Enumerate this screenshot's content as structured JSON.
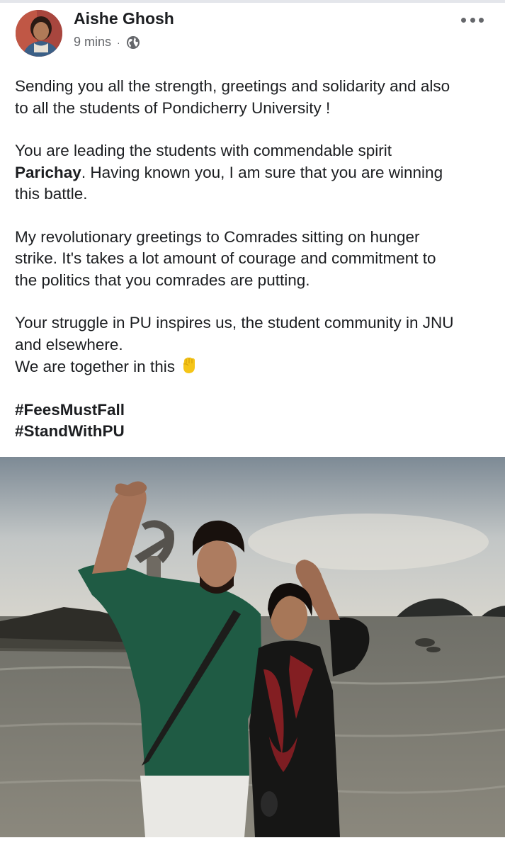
{
  "post": {
    "author": "Aishe Ghosh",
    "time": "9 mins",
    "separator": "·",
    "privacy_icon": "globe-icon",
    "menu_icon": "more-horizontal-icon",
    "paragraphs": {
      "p1": {
        "line1": "Sending you all the strength, greetings and solidarity and also",
        "line2": "to all the students of Pondicherry University !"
      },
      "p2": {
        "line1": "You are leading the students with commendable spirit",
        "name": "Parichay",
        "line2_rest": ". Having known you, I am sure that you are winning",
        "line3": "this battle."
      },
      "p3": {
        "line1": "My revolutionary greetings to Comrades sitting on hunger",
        "line2": "strike. It's takes a lot amount of courage and commitment to",
        "line3": "the politics that you comrades are putting."
      },
      "p4": {
        "line1": "Your struggle in PU inspires us, the student community in JNU",
        "line2": "and elsewhere.",
        "line3": "We are together in this",
        "emoji_icon": "raised-fist-icon"
      }
    },
    "hashtags": [
      "#FeesMustFall",
      "#StandWithPU"
    ]
  },
  "colors": {
    "text": "#1c1e21",
    "secondary_text": "#65676b",
    "background": "#ffffff",
    "emoji": "#f5c518"
  }
}
